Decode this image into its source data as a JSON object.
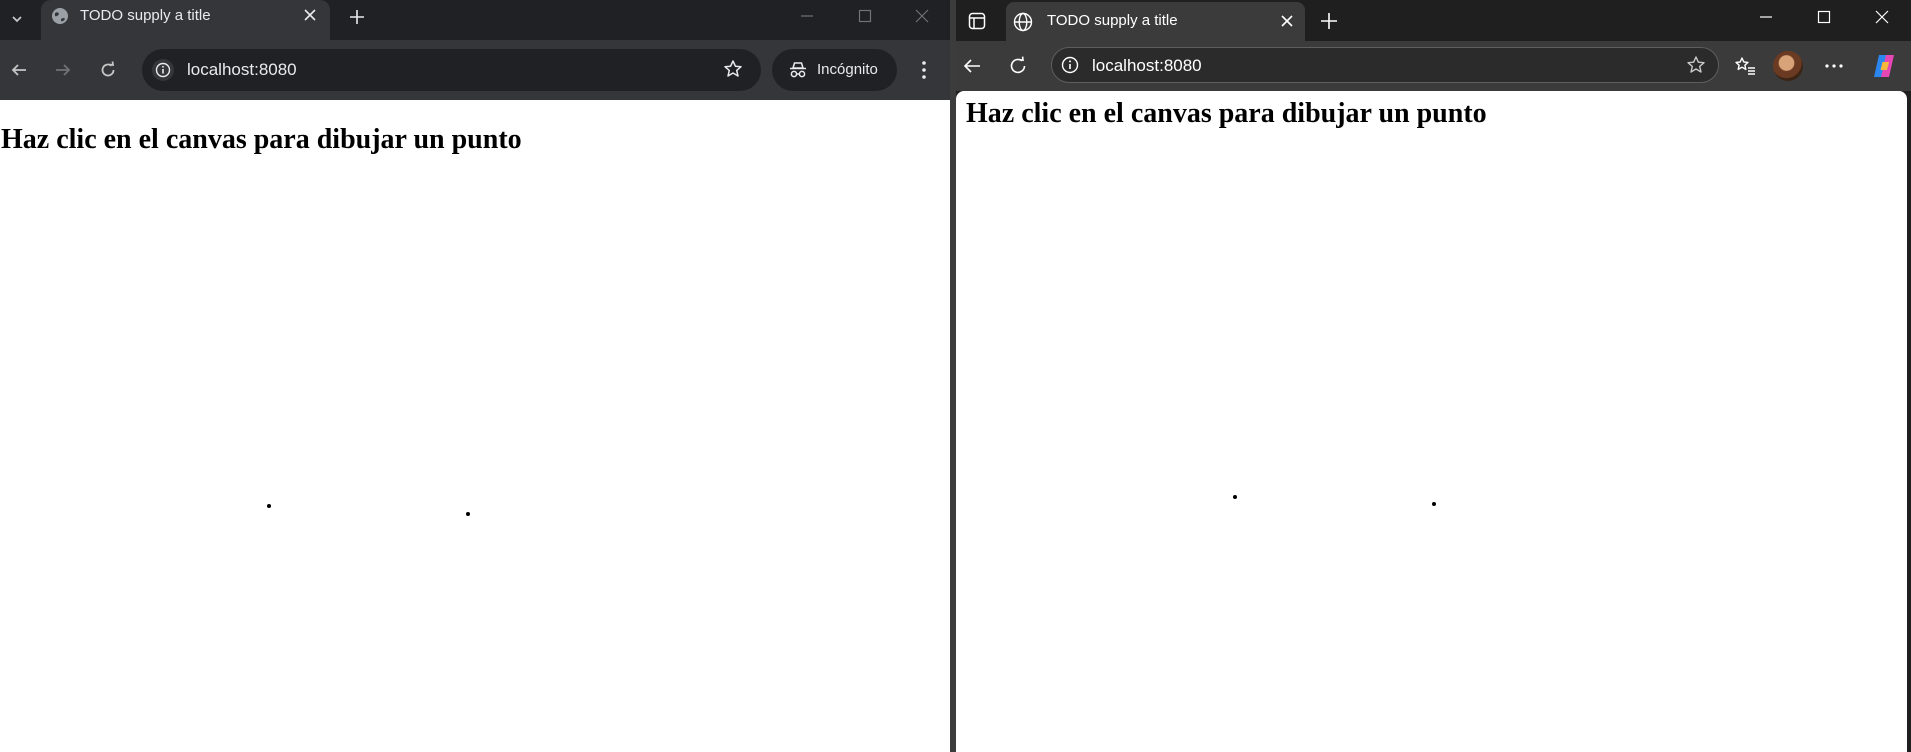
{
  "chrome": {
    "tab": {
      "title": "TODO supply a title"
    },
    "address": {
      "url": "localhost:8080"
    },
    "incognito": {
      "label": "Incógnito"
    },
    "page": {
      "heading": "Haz clic en el canvas para dibujar un punto"
    }
  },
  "edge": {
    "tab": {
      "title": "TODO supply a title"
    },
    "address": {
      "url": "localhost:8080"
    },
    "page": {
      "heading": "Haz clic en el canvas para dibujar un punto"
    }
  }
}
